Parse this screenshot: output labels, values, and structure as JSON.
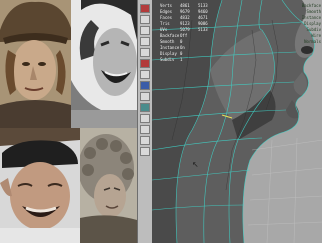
{
  "photos": [
    {
      "name": "hat-portrait",
      "tone": "#8a7a64"
    },
    {
      "name": "laughing-bw",
      "tone": "#cfcfcf"
    },
    {
      "name": "laughing-cap",
      "tone": "#5e4a3c"
    },
    {
      "name": "curly-hair",
      "tone": "#9c9586"
    }
  ],
  "viewport": {
    "background": "#a9a9a9",
    "hud": [
      {
        "key": "Verts",
        "a": "4861",
        "b": "5133"
      },
      {
        "key": "Edges",
        "a": "9679",
        "b": "9460"
      },
      {
        "key": "Faces",
        "a": "4832",
        "b": "4671"
      },
      {
        "key": "Tris",
        "a": "9123",
        "b": "9086"
      },
      {
        "key": "UVs",
        "a": "5079",
        "b": "5133"
      },
      {
        "key": "Backface",
        "a": "Off",
        "b": ""
      },
      {
        "key": "Smooth",
        "a": "0",
        "b": ""
      },
      {
        "key": "Instance",
        "a": "On",
        "b": ""
      },
      {
        "key": "Display",
        "a": "0",
        "b": ""
      },
      {
        "key": "Subdiv",
        "a": "1",
        "b": ""
      }
    ],
    "side_list": [
      "Backface",
      "Smooth",
      "Instance",
      "Display",
      "Subdiv",
      "Wire",
      "Normals"
    ]
  },
  "toolbar": {
    "buttons": [
      {
        "icon": "select-icon",
        "style": "tb-red"
      },
      {
        "icon": "lasso-icon",
        "style": ""
      },
      {
        "icon": "move-icon",
        "style": ""
      },
      {
        "icon": "rotate-icon",
        "style": ""
      },
      {
        "icon": "scale-icon",
        "style": ""
      },
      {
        "icon": "manip-icon",
        "style": "tb-red"
      },
      {
        "icon": "last-tool-icon",
        "style": ""
      },
      {
        "icon": "grid-icon",
        "style": "tb-blue"
      },
      {
        "icon": "camera-icon",
        "style": ""
      },
      {
        "icon": "layout-single-icon",
        "style": "tb-teal"
      },
      {
        "icon": "layout-four-icon",
        "style": ""
      },
      {
        "icon": "outliner-icon",
        "style": ""
      },
      {
        "icon": "graph-icon",
        "style": ""
      },
      {
        "icon": "render-icon",
        "style": ""
      }
    ]
  }
}
